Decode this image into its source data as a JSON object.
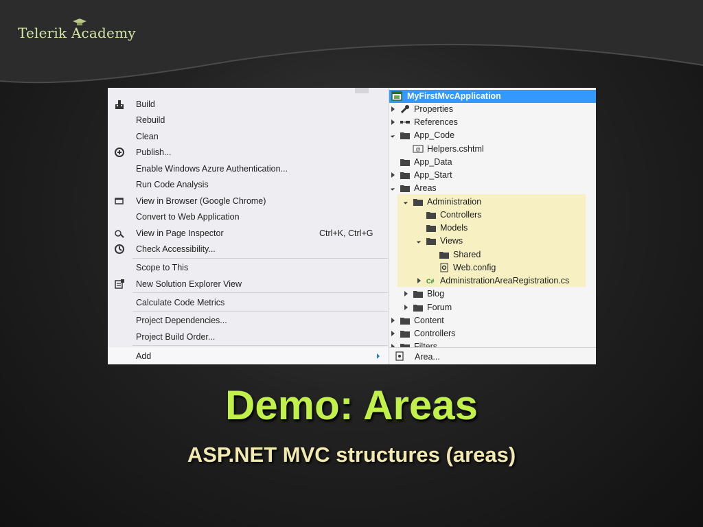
{
  "logo": {
    "text": "Telerik Academy"
  },
  "context_menu": {
    "items": [
      {
        "label": "Build",
        "icon": "build-icon"
      },
      {
        "label": "Rebuild"
      },
      {
        "label": "Clean"
      },
      {
        "label": "Publish...",
        "icon": "publish-icon"
      },
      {
        "label": "Enable Windows Azure Authentication..."
      },
      {
        "label": "Run Code Analysis"
      },
      {
        "label": "View in Browser (Google Chrome)",
        "icon": "browser-icon"
      },
      {
        "label": "Convert to Web Application"
      },
      {
        "label": "View in Page Inspector",
        "shortcut": "Ctrl+K, Ctrl+G",
        "icon": "page-inspector-icon"
      },
      {
        "label": "Check Accessibility...",
        "icon": "accessibility-icon"
      },
      {
        "label": "Scope to This"
      },
      {
        "label": "New Solution Explorer View",
        "icon": "new-view-icon"
      },
      {
        "label": "Calculate Code Metrics"
      },
      {
        "label": "Project Dependencies..."
      },
      {
        "label": "Project Build Order..."
      },
      {
        "label": "Add",
        "submenu": true
      }
    ]
  },
  "submenu": {
    "label": "Area..."
  },
  "solution_explorer": {
    "root": "MyFirstMvcApplication",
    "nodes": [
      {
        "label": "Properties"
      },
      {
        "label": "References"
      },
      {
        "label": "App_Code"
      },
      {
        "label": "Helpers.cshtml"
      },
      {
        "label": "App_Data"
      },
      {
        "label": "App_Start"
      },
      {
        "label": "Areas"
      },
      {
        "label": "Administration"
      },
      {
        "label": "Controllers"
      },
      {
        "label": "Models"
      },
      {
        "label": "Views"
      },
      {
        "label": "Shared"
      },
      {
        "label": "Web.config"
      },
      {
        "label": "AdministrationAreaRegistration.cs"
      },
      {
        "label": "Blog"
      },
      {
        "label": "Forum"
      },
      {
        "label": "Content"
      },
      {
        "label": "Controllers"
      },
      {
        "label": "Filters"
      }
    ]
  },
  "slide": {
    "title": "Demo: Areas",
    "subtitle": "ASP.NET MVC structures (areas)"
  },
  "colors": {
    "title": "#c2f04a",
    "subtitle": "#f2e9b0",
    "selection": "#3399ff",
    "highlight": "#f6f0c2"
  }
}
